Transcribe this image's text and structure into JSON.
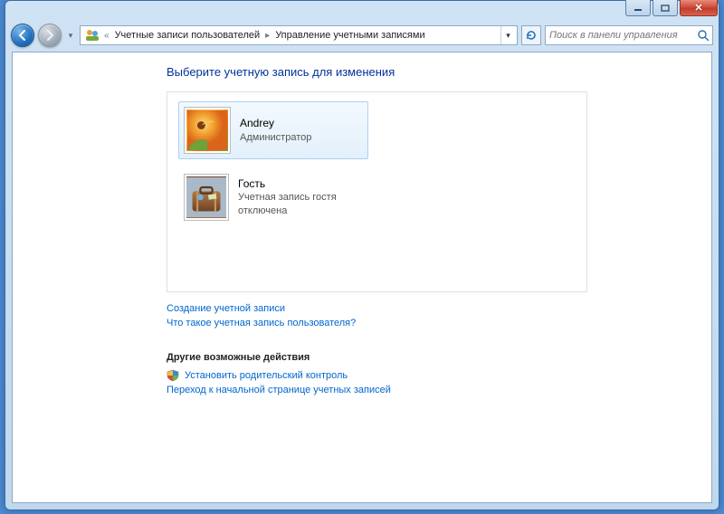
{
  "window": {
    "title": ""
  },
  "breadcrumb": {
    "seg1": "Учетные записи пользователей",
    "seg2": "Управление учетными записями"
  },
  "search": {
    "placeholder": "Поиск в панели управления"
  },
  "page": {
    "title": "Выберите учетную запись для изменения"
  },
  "accounts": [
    {
      "name": "Andrey",
      "role": "Администратор",
      "selected": true,
      "avatar": "flower"
    },
    {
      "name": "Гость",
      "role": "Учетная запись гостя отключена",
      "selected": false,
      "avatar": "guest"
    }
  ],
  "links": {
    "create": "Создание учетной записи",
    "whatis": "Что такое учетная запись пользователя?"
  },
  "other": {
    "heading": "Другие возможные действия",
    "parental": "Установить родительский контроль",
    "goto": "Переход к начальной странице учетных записей"
  }
}
